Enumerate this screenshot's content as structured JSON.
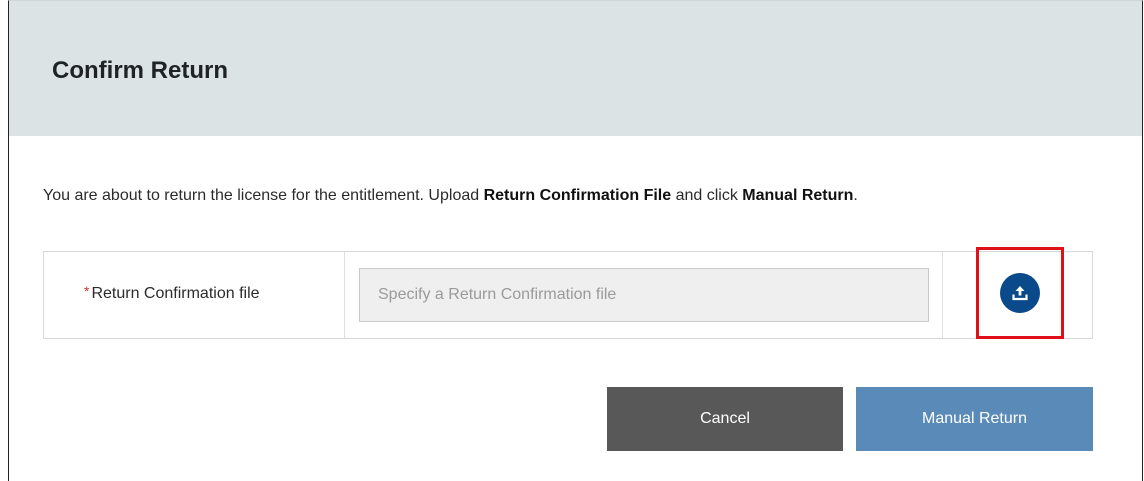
{
  "dialog": {
    "title": "Confirm Return",
    "message": {
      "part1": "You are about to return the license for the entitlement. Upload ",
      "bold1": "Return Confirmation File",
      "part2": " and click ",
      "bold2": "Manual Return",
      "part3": "."
    }
  },
  "file_field": {
    "required_marker": "*",
    "label": "Return Confirmation file",
    "value": "",
    "placeholder": "Specify a Return Confirmation file",
    "upload_icon": "upload-icon"
  },
  "buttons": {
    "cancel_label": "Cancel",
    "manual_return_label": "Manual Return"
  },
  "colors": {
    "header_background": "#dce3e5",
    "upload_button": "#0a4a8a",
    "highlight": "#e0101a",
    "cancel_button": "#585858",
    "manual_return_button": "#5a8ab7",
    "required_marker": "#d0312d"
  }
}
